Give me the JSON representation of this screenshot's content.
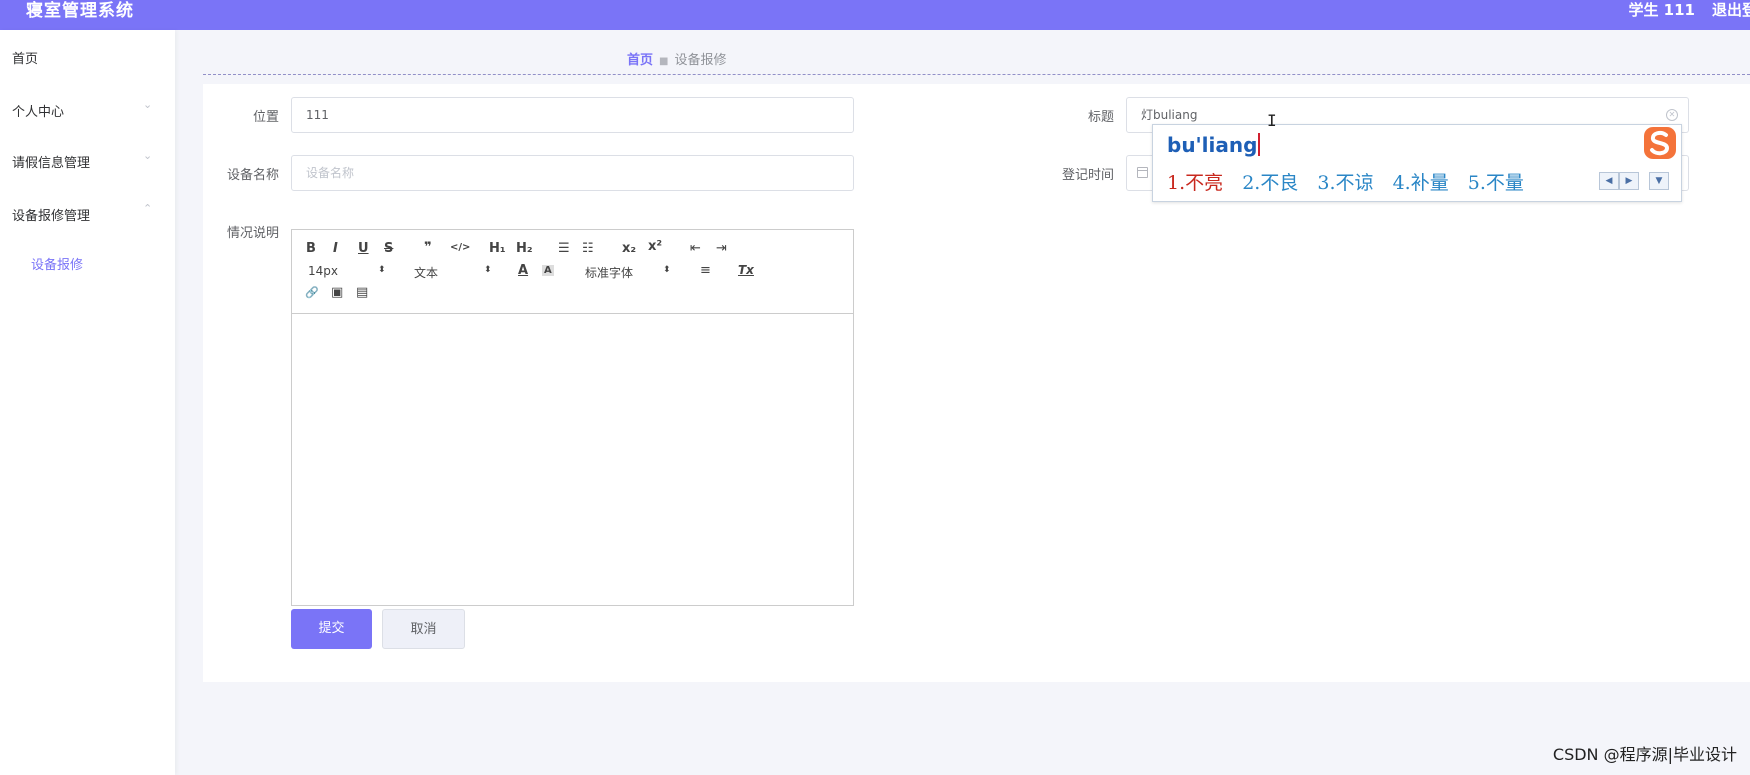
{
  "header": {
    "app_title": "寝室管理系统",
    "user_label": "学生 111",
    "logout_label": "退出登录"
  },
  "sidebar": {
    "items": [
      {
        "label": "首页",
        "has_arrow": false
      },
      {
        "label": "个人中心",
        "has_arrow": true,
        "arrow": "⌄"
      },
      {
        "label": "请假信息管理",
        "has_arrow": true,
        "arrow": "⌄"
      },
      {
        "label": "设备报修管理",
        "has_arrow": true,
        "arrow": "⌃"
      }
    ],
    "sub_item": "设备报修"
  },
  "breadcrumb": {
    "home": "首页",
    "separator": "■",
    "current": "设备报修"
  },
  "form": {
    "location": {
      "label": "位置",
      "value": "111"
    },
    "device_name": {
      "label": "设备名称",
      "placeholder": "设备名称"
    },
    "description": {
      "label": "情况说明"
    },
    "title": {
      "label": "标题",
      "value": "灯buliang"
    },
    "register_time": {
      "label": "登记时间"
    }
  },
  "editor_toolbar": {
    "bold": "B",
    "italic": "I",
    "underline": "U",
    "strike": "S",
    "quote": "❞",
    "code": "</>",
    "h1": "H₁",
    "h2": "H₂",
    "ordered_list": "☰",
    "bullet_list": "☷",
    "subscript": "x₂",
    "superscript": "x²",
    "outdent": "⇤",
    "indent": "⇥",
    "font_size": "14px",
    "text_type": "文本",
    "font_color": "A",
    "bg_color": "A",
    "font_family": "标准字体",
    "align": "≡",
    "clear_format": "Tx",
    "link": "🔗",
    "image": "▣",
    "video": "▤",
    "dropdown_caret": "⬍"
  },
  "buttons": {
    "submit": "提交",
    "cancel": "取消"
  },
  "ime": {
    "pinyin": "bu'liang",
    "candidates": [
      "1.不亮",
      "2.不良",
      "3.不谅",
      "4.补量",
      "5.不量"
    ],
    "prev": "◀",
    "next": "▶",
    "more": "▼"
  },
  "watermark": "CSDN @程序源|毕业设计",
  "colors": {
    "accent": "#7a74f7",
    "ime_pinyin": "#1e5fb6",
    "ime_first": "#c8281e",
    "ime_cand": "#2a86c6"
  }
}
